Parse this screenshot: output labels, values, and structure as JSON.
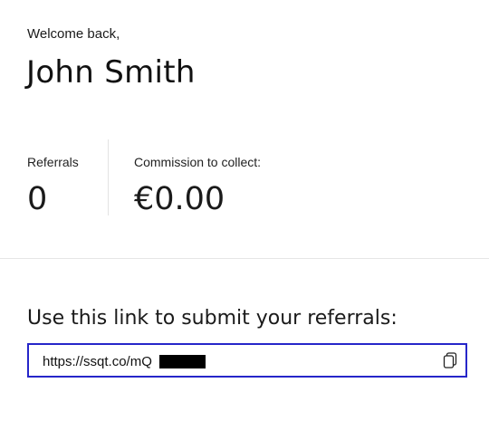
{
  "greeting": {
    "welcome": "Welcome back,",
    "name": "John Smith"
  },
  "stats": {
    "referrals_label": "Referrals",
    "referrals_value": "0",
    "commission_label": "Commission to collect:",
    "commission_value": "€0.00"
  },
  "referral_link": {
    "heading": "Use this link to submit your referrals:",
    "value_visible": "https://ssqt.co/mQ",
    "copy_icon": "copy-icon",
    "accent_color": "#2626c9"
  }
}
